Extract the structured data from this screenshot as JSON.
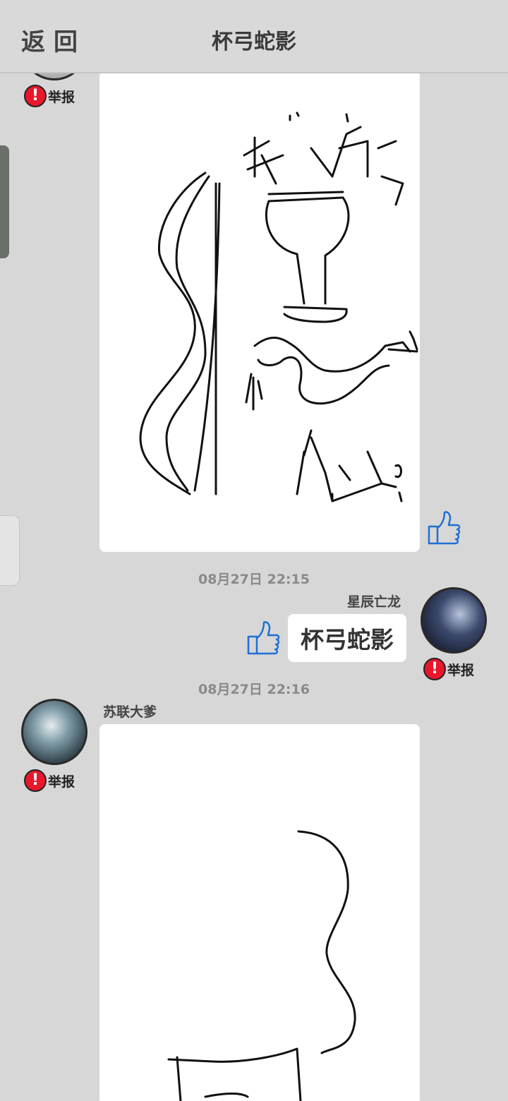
{
  "header": {
    "back_label": "返回",
    "title": "杯弓蛇影"
  },
  "report_label": "举报",
  "messages": [
    {
      "type": "drawing"
    },
    {
      "timestamp": "08月27日  22:15",
      "username": "星辰亡龙",
      "text": "杯弓蛇影"
    },
    {
      "timestamp": "08月27日  22:16",
      "username": "苏联大爹",
      "type": "drawing"
    }
  ],
  "colors": {
    "report": "#e8172c",
    "thumb": "#1f6fd6",
    "background": "#d7d7d7"
  },
  "icons": {
    "report": "exclamation-circle-icon",
    "like": "thumbs-up-icon"
  }
}
